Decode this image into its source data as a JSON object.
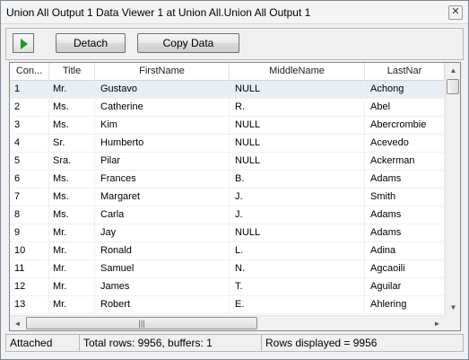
{
  "window": {
    "title": "Union All Output 1 Data Viewer 1 at Union All.Union All Output 1",
    "close_glyph": "✕"
  },
  "toolbar": {
    "play_icon": "play-icon",
    "detach_label": "Detach",
    "copy_label": "Copy Data"
  },
  "grid": {
    "columns": [
      "Con...",
      "Title",
      "FirstName",
      "MiddleName",
      "LastNar"
    ],
    "rows": [
      [
        "1",
        "Mr.",
        "Gustavo",
        "NULL",
        "Achong"
      ],
      [
        "2",
        "Ms.",
        "Catherine",
        "R.",
        "Abel"
      ],
      [
        "3",
        "Ms.",
        "Kim",
        "NULL",
        "Abercrombie"
      ],
      [
        "4",
        "Sr.",
        "Humberto",
        "NULL",
        "Acevedo"
      ],
      [
        "5",
        "Sra.",
        "Pilar",
        "NULL",
        "Ackerman"
      ],
      [
        "6",
        "Ms.",
        "Frances",
        "B.",
        "Adams"
      ],
      [
        "7",
        "Ms.",
        "Margaret",
        "J.",
        "Smith"
      ],
      [
        "8",
        "Ms.",
        "Carla",
        "J.",
        "Adams"
      ],
      [
        "9",
        "Mr.",
        "Jay",
        "NULL",
        "Adams"
      ],
      [
        "10",
        "Mr.",
        "Ronald",
        "L.",
        "Adina"
      ],
      [
        "11",
        "Mr.",
        "Samuel",
        "N.",
        "Agcaoili"
      ],
      [
        "12",
        "Mr.",
        "James",
        "T.",
        "Aguilar"
      ],
      [
        "13",
        "Mr.",
        "Robert",
        "E.",
        "Ahlering"
      ]
    ],
    "selected_row": 0,
    "scroll": {
      "up": "▲",
      "down": "▼",
      "left": "◄",
      "right": "►",
      "grip": "|||"
    }
  },
  "status": {
    "state": "Attached",
    "total": "Total rows: 9956, buffers: 1",
    "displayed": "Rows displayed = 9956"
  }
}
